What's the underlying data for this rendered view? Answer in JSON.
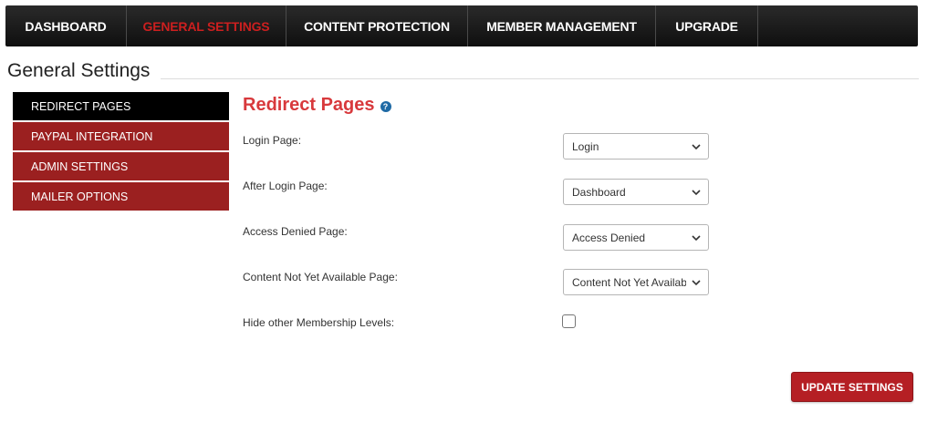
{
  "topnav": {
    "items": [
      {
        "label": "DASHBOARD",
        "active": false
      },
      {
        "label": "GENERAL SETTINGS",
        "active": true
      },
      {
        "label": "CONTENT PROTECTION",
        "active": false
      },
      {
        "label": "MEMBER MANAGEMENT",
        "active": false
      },
      {
        "label": "UPGRADE",
        "active": false
      }
    ]
  },
  "page": {
    "title": "General Settings"
  },
  "sidebar": {
    "items": [
      {
        "label": "REDIRECT PAGES",
        "active": true
      },
      {
        "label": "PAYPAL INTEGRATION",
        "active": false
      },
      {
        "label": "ADMIN SETTINGS",
        "active": false
      },
      {
        "label": "MAILER OPTIONS",
        "active": false
      }
    ]
  },
  "section": {
    "title": "Redirect Pages",
    "help_icon": "question-circle-icon"
  },
  "form": {
    "login_page": {
      "label": "Login Page:",
      "value": "Login"
    },
    "after_login_page": {
      "label": "After Login Page:",
      "value": "Dashboard"
    },
    "access_denied_page": {
      "label": "Access Denied Page:",
      "value": "Access Denied"
    },
    "content_not_available_page": {
      "label": "Content Not Yet Available Page:",
      "value": "Content Not Yet Available"
    },
    "hide_levels": {
      "label": "Hide other Membership Levels:",
      "checked": false
    }
  },
  "actions": {
    "update_label": "UPDATE SETTINGS"
  },
  "colors": {
    "accent_red": "#d8393c",
    "sidebar_red": "#9b2020",
    "button_red": "#b51f24",
    "nav_dark": "#1a1a1a",
    "help_blue": "#1f6aa5"
  }
}
